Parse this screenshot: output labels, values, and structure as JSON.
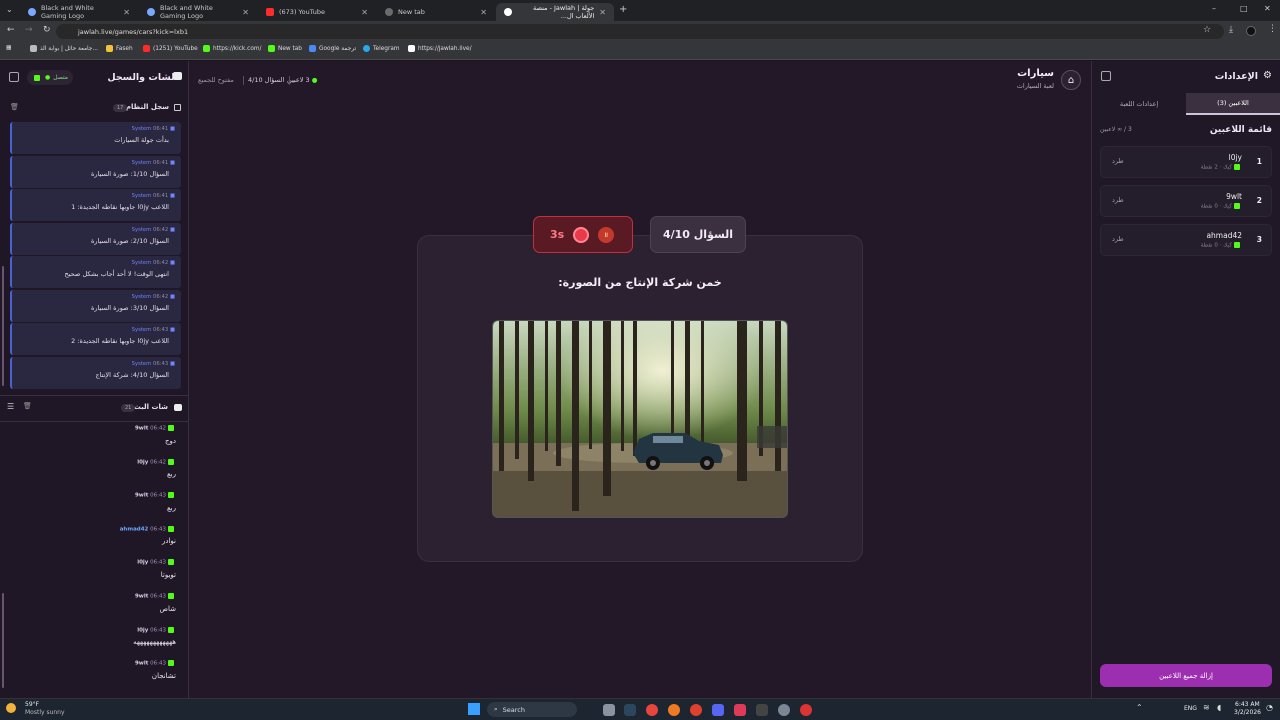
{
  "browser": {
    "tabs": [
      {
        "title": "Black and White Gaming Logo"
      },
      {
        "title": "Black and White Gaming Logo"
      },
      {
        "title": "(673) YouTube"
      },
      {
        "title": "New tab"
      },
      {
        "title": "جولة | Jawlah - منصة الألعاب ال..."
      }
    ],
    "url": "jawlah.live/games/cars?kick=lxb1",
    "bookmarks": [
      "جامعة حائل | بوابة الذ...",
      "Faseh",
      "(1251) YouTube",
      "https://kick.com/",
      "New tab",
      "Google ترجمة",
      "Telegram",
      "https://jawlah.live/"
    ]
  },
  "left": {
    "title": "الشات والسجل",
    "status": "متصل",
    "system_log": {
      "title": "سجل النظام",
      "count": "17",
      "entries": [
        {
          "time": "06:41",
          "source": "System",
          "text": "بدأت جولة السيارات"
        },
        {
          "time": "06:41",
          "source": "System",
          "text": "السؤال 1/10: صورة السيارة"
        },
        {
          "time": "06:41",
          "source": "System",
          "text": "اللاعب l0jy جاوبها نقاطه الجديدة: 1"
        },
        {
          "time": "06:42",
          "source": "System",
          "text": "السؤال 2/10: صورة السيارة"
        },
        {
          "time": "06:42",
          "source": "System",
          "text": "انتهى الوقت! لا أحد أجاب بشكل صحيح"
        },
        {
          "time": "06:42",
          "source": "System",
          "text": "السؤال 3/10: صورة السيارة"
        },
        {
          "time": "06:43",
          "source": "System",
          "text": "اللاعب l0jy جاوبها نقاطه الجديدة: 2"
        },
        {
          "time": "06:43",
          "source": "System",
          "text": "السؤال 4/10: شركة الإنتاج"
        }
      ]
    },
    "chat": {
      "title": "شات البث",
      "count": "21",
      "messages": [
        {
          "user": "9wlt",
          "time": "06:42",
          "text": "دوج"
        },
        {
          "user": "l0jy",
          "time": "06:42",
          "text": "ربع"
        },
        {
          "user": "9wlt",
          "time": "06:43",
          "text": "ربع"
        },
        {
          "user": "ahmad42",
          "time": "06:43",
          "text": "نوادر"
        },
        {
          "user": "l0jy",
          "time": "06:43",
          "text": "تويوتا"
        },
        {
          "user": "9wlt",
          "time": "06:43",
          "text": "شاص"
        },
        {
          "user": "l0jy",
          "time": "06:43",
          "text": "ههههههههههههه"
        },
        {
          "user": "9wlt",
          "time": "06:43",
          "text": "تشانجان"
        }
      ]
    }
  },
  "header": {
    "title": "سيارات",
    "subtitle": "لعبة السيارات",
    "players_count": "3 لاعبين",
    "question_label": "السؤال 4/10",
    "open_label": "مفتوح للجميع"
  },
  "game": {
    "timer": "3s",
    "question": "السؤال 4/10",
    "prompt": "خمن شركة الإنتاج من الصورة:"
  },
  "right": {
    "title": "الإعدادات",
    "tab_players": "اللاعبين (3)",
    "tab_settings": "إعدادات اللعبة",
    "list_title": "قائمة اللاعبين",
    "list_count": "3 / ∞ لاعبين",
    "kick_label": "طرد",
    "players": [
      {
        "rank": "1",
        "name": "l0jy",
        "meta": "كيك · 2 نقطة"
      },
      {
        "rank": "2",
        "name": "9wlt",
        "meta": "كيك · 0 نقطة"
      },
      {
        "rank": "3",
        "name": "ahmad42",
        "meta": "كيك · 0 نقطة"
      }
    ],
    "remove_all": "إزالة جميع اللاعبين"
  },
  "taskbar": {
    "weather_temp": "59°F",
    "weather_desc": "Mostly sunny",
    "search": "Search",
    "lang": "ENG",
    "time": "6:43 AM",
    "date": "3/2/2026"
  }
}
